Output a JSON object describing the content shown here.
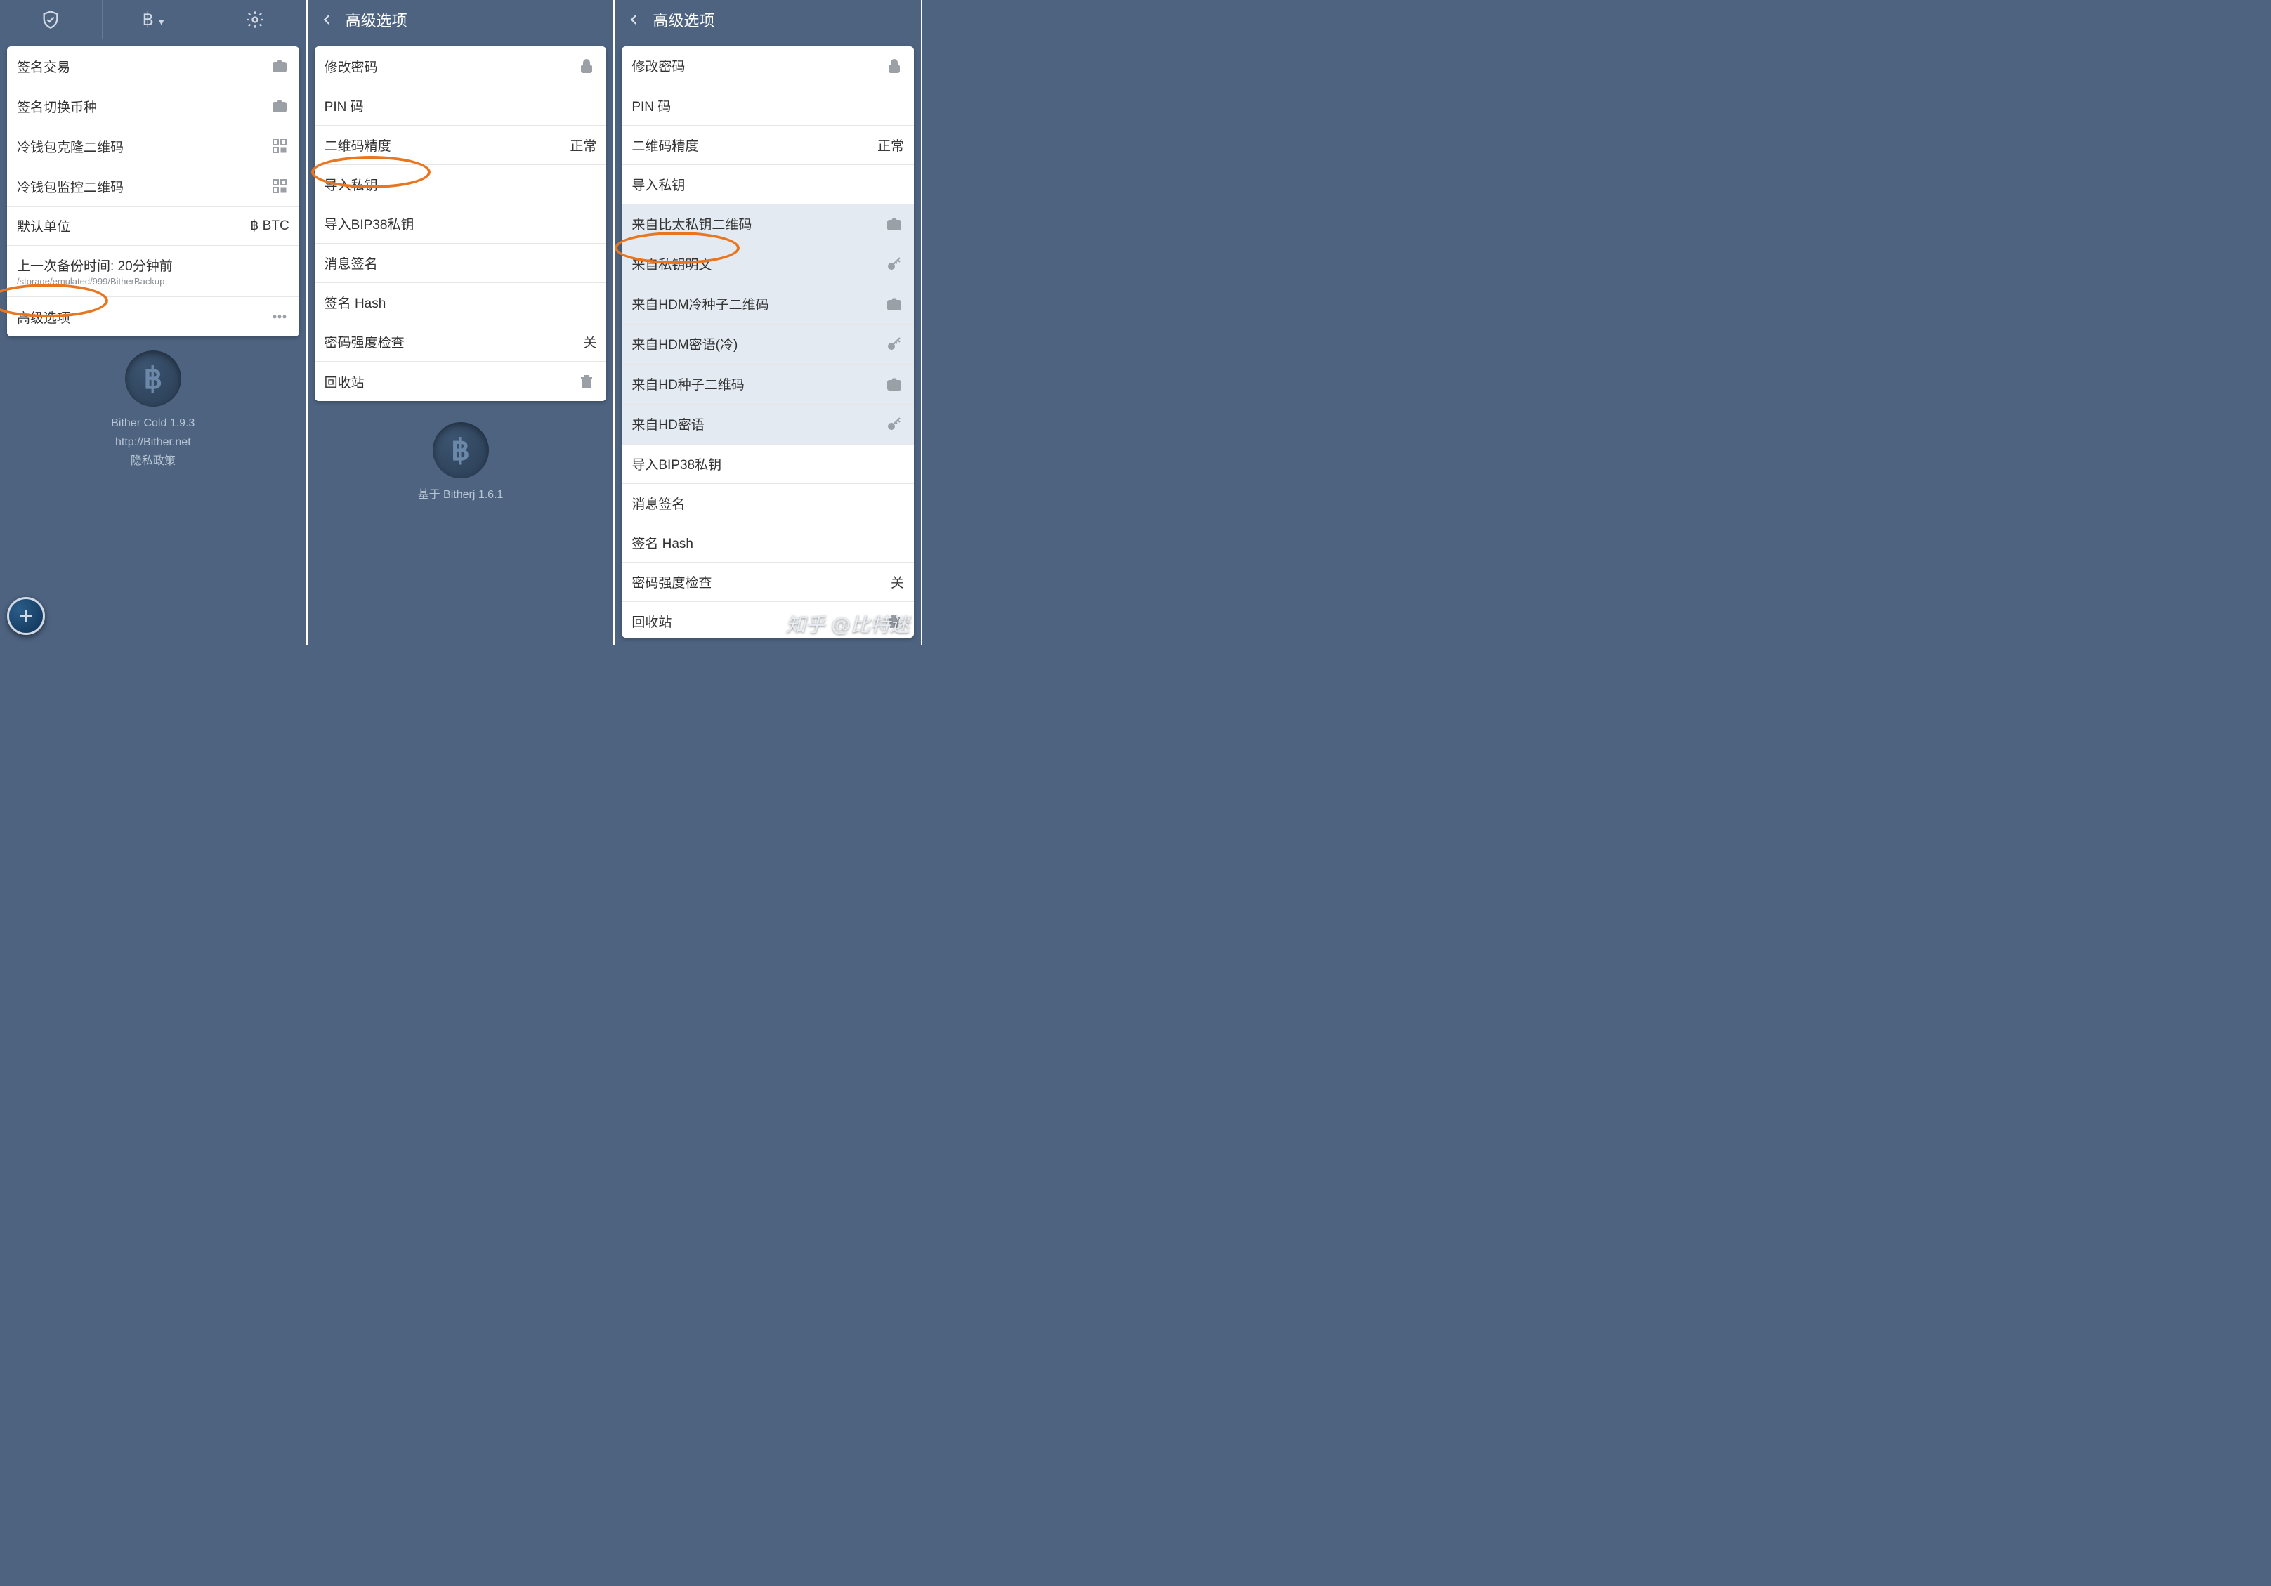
{
  "pane1": {
    "rows": [
      {
        "label": "签名交易",
        "icon": "camera"
      },
      {
        "label": "签名切换币种",
        "icon": "camera"
      },
      {
        "label": "冷钱包克隆二维码",
        "icon": "qr"
      },
      {
        "label": "冷钱包监控二维码",
        "icon": "qr"
      },
      {
        "label": "默认单位",
        "value": "฿ BTC"
      },
      {
        "label": "上一次备份时间: 20分钟前",
        "sublabel": "/storage/emulated/999/BitherBackup"
      },
      {
        "label": "高级选项",
        "icon": "more"
      }
    ],
    "footer": {
      "appname": "Bither Cold 1.9.3",
      "url": "http://Bither.net",
      "privacy": "隐私政策"
    }
  },
  "pane2": {
    "title": "高级选项",
    "rows": [
      {
        "label": "修改密码",
        "icon": "lock"
      },
      {
        "label": "PIN 码"
      },
      {
        "label": "二维码精度",
        "value": "正常"
      },
      {
        "label": "导入私钥"
      },
      {
        "label": "导入BIP38私钥"
      },
      {
        "label": "消息签名"
      },
      {
        "label": "签名 Hash"
      },
      {
        "label": "密码强度检查",
        "value": "关"
      },
      {
        "label": "回收站",
        "icon": "trash"
      }
    ],
    "footer": {
      "based": "基于 Bitherj 1.6.1"
    }
  },
  "pane3": {
    "title": "高级选项",
    "rows": [
      {
        "label": "修改密码",
        "icon": "lock"
      },
      {
        "label": "PIN 码"
      },
      {
        "label": "二维码精度",
        "value": "正常"
      },
      {
        "label": "导入私钥"
      },
      {
        "label": "来自比太私钥二维码",
        "icon": "camera",
        "sub": true
      },
      {
        "label": "来自私钥明文",
        "icon": "key",
        "sub": true
      },
      {
        "label": "来自HDM冷种子二维码",
        "icon": "camera",
        "sub": true
      },
      {
        "label": "来自HDM密语(冷)",
        "icon": "key",
        "sub": true
      },
      {
        "label": "来自HD种子二维码",
        "icon": "camera",
        "sub": true
      },
      {
        "label": "来自HD密语",
        "icon": "key",
        "sub": true
      },
      {
        "label": "导入BIP38私钥"
      },
      {
        "label": "消息签名"
      },
      {
        "label": "签名 Hash"
      },
      {
        "label": "密码强度检查",
        "value": "关"
      },
      {
        "label": "回收站",
        "icon": "trash"
      }
    ]
  },
  "watermark": "知乎 @比特迷"
}
